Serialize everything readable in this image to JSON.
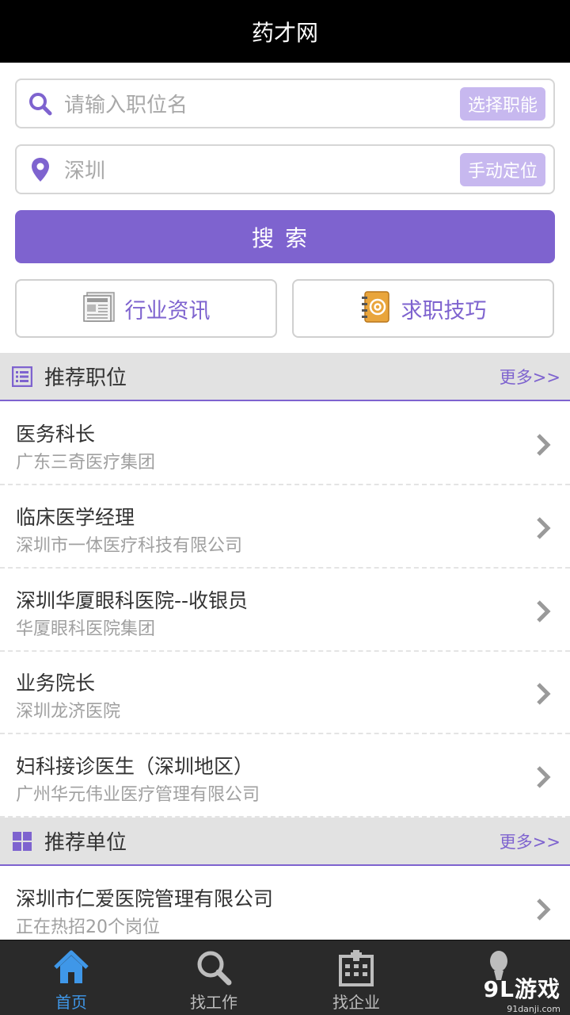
{
  "app": {
    "title": "药才网"
  },
  "search": {
    "job_placeholder": "请输入职位名",
    "select_job_label": "选择职能",
    "location_value": "深圳",
    "locate_label": "手动定位",
    "search_label": "搜索"
  },
  "quick_links": [
    {
      "label": "行业资讯",
      "icon": "newspaper-icon"
    },
    {
      "label": "求职技巧",
      "icon": "address-book-icon"
    }
  ],
  "recommended_jobs": {
    "title": "推荐职位",
    "more_label": "更多>>",
    "items": [
      {
        "title": "医务科长",
        "company": "广东三奇医疗集团"
      },
      {
        "title": "临床医学经理",
        "company": "深圳市一体医疗科技有限公司"
      },
      {
        "title": "深圳华厦眼科医院--收银员",
        "company": "华厦眼科医院集团"
      },
      {
        "title": "业务院长",
        "company": "深圳龙济医院"
      },
      {
        "title": "妇科接诊医生（深圳地区）",
        "company": "广州华元伟业医疗管理有限公司"
      }
    ]
  },
  "recommended_companies": {
    "title": "推荐单位",
    "more_label": "更多>>",
    "items": [
      {
        "name": "深圳市仁爱医院管理有限公司",
        "info": "正在热招20个岗位"
      }
    ]
  },
  "tabbar": {
    "items": [
      {
        "label": "首页",
        "icon": "home-icon",
        "active": true
      },
      {
        "label": "找工作",
        "icon": "search-icon",
        "active": false
      },
      {
        "label": "找企业",
        "icon": "building-icon",
        "active": false
      },
      {
        "label": "",
        "icon": "profile-icon",
        "active": false
      }
    ]
  },
  "watermark": {
    "brand": "9L游戏",
    "url": "91danji.com"
  },
  "colors": {
    "accent": "#7e63cf",
    "active_tab": "#3f97e8",
    "titlebar": "#000000"
  }
}
